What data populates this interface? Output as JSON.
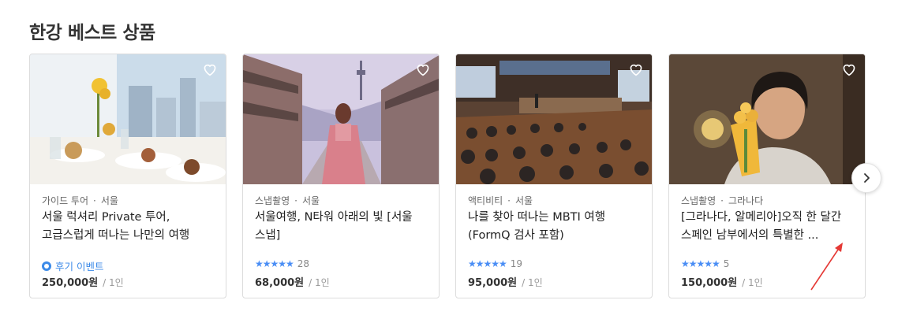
{
  "section": {
    "title": "한강 베스트 상품"
  },
  "cards": [
    {
      "category": "가이드 투어",
      "location": "서울",
      "title": "서울 럭셔리 Private 투어, 고급스럽게 떠나는 나만의 여행",
      "event_label": "후기 이벤트",
      "price": "250,000원",
      "unit": "/ 1인"
    },
    {
      "category": "스냅촬영",
      "location": "서울",
      "title": "서울여행, N타워 아래의 빛 [서울 스냅]",
      "stars": "★★★★★",
      "review_count": "28",
      "price": "68,000원",
      "unit": "/ 1인"
    },
    {
      "category": "액티비티",
      "location": "서울",
      "title": "나를 찾아 떠나는 MBTI 여행 (FormQ 검사 포함)",
      "stars": "★★★★★",
      "review_count": "19",
      "price": "95,000원",
      "unit": "/ 1인"
    },
    {
      "category": "스냅촬영",
      "location": "그라나다",
      "title": "[그라나다, 알메리아]오직 한 달간 스페인 남부에서의 특별한 ...",
      "stars": "★★★★★",
      "review_count": "5",
      "price": "150,000원",
      "unit": "/ 1인"
    }
  ],
  "icons": {
    "heart": "heart-outline-icon",
    "next": "chevron-right-icon",
    "event": "event-badge-icon",
    "star": "star-icon"
  },
  "colors": {
    "accent": "#4a8ef5",
    "event": "#3c8ae8",
    "annotation": "#e53935"
  }
}
